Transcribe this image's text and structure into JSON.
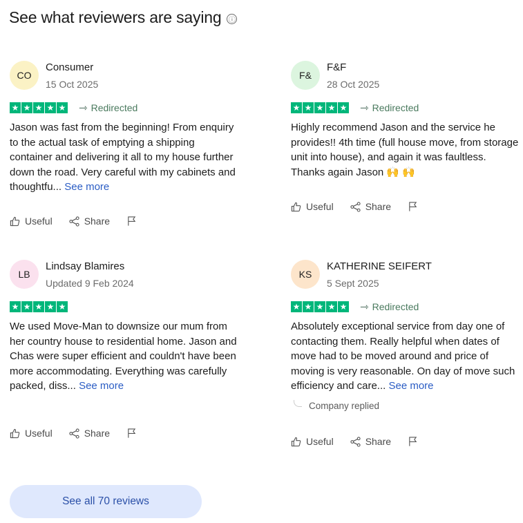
{
  "header": {
    "title": "See what reviewers are saying",
    "info_icon": "ⓘ"
  },
  "reviews": [
    {
      "initials": "CO",
      "avatar_color": "#fbf2c5",
      "name": "Consumer",
      "date": "15 Oct 2025",
      "stars": 5,
      "redirected": "Redirected",
      "text": "Jason was fast from the beginning! From enquiry to the actual task of emptying a shipping container and delivering it all to my house further down the road. Very careful with my cabinets and thoughtfu...",
      "see_more": "See more",
      "useful": "Useful",
      "share": "Share"
    },
    {
      "initials": "F&",
      "avatar_color": "#dcf5df",
      "name": "F&F",
      "date": "28 Oct 2025",
      "stars": 5,
      "redirected": "Redirected",
      "text": "Highly recommend Jason and the service he provides!! 4th time (full house move, from storage unit into house), and again it was faultless. Thanks again Jason 🙌 🙌",
      "useful": "Useful",
      "share": "Share"
    },
    {
      "initials": "LB",
      "avatar_color": "#fbe1ee",
      "name": "Lindsay Blamires",
      "date": "Updated 9 Feb 2024",
      "stars": 5,
      "text": "We used Move-Man to downsize our mum from her country house to residential home. Jason and Chas were super efficient and couldn't have been more accommodating. Everything was carefully packed, diss...",
      "see_more": "See more",
      "useful": "Useful",
      "share": "Share"
    },
    {
      "initials": "KS",
      "avatar_color": "#fde5cb",
      "name": "KATHERINE SEIFERT",
      "date": "5 Sept 2025",
      "stars": 5,
      "redirected": "Redirected",
      "text": "Absolutely exceptional service from day one of contacting them. Really helpful when dates of move had to be moved around and price of moving is very reasonable. On day of move such efficiency and care...",
      "see_more": "See more",
      "company_replied": "Company replied",
      "useful": "Useful",
      "share": "Share"
    }
  ],
  "footer": {
    "see_all_label": "See all 70 reviews"
  },
  "colors": {
    "star_green": "#00b67a",
    "link_blue": "#2a5cc4",
    "button_bg": "#dfe8fd"
  }
}
